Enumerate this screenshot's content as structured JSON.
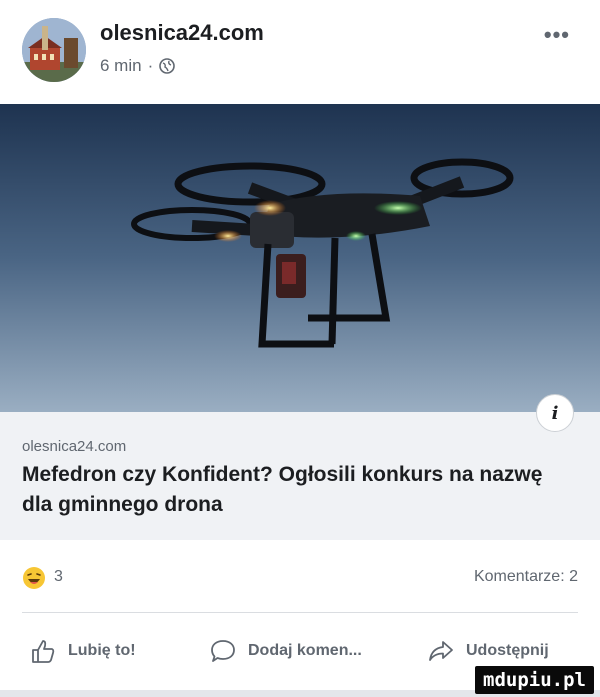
{
  "post": {
    "page_name": "olesnica24.com",
    "time": "6 min",
    "meta_separator": "·",
    "more_label": "•••"
  },
  "link": {
    "domain": "olesnica24.com",
    "headline": "Mefedron czy Konfident? Ogłosili konkurs na nazwę dla gminnego drona",
    "info_label": "i"
  },
  "stats": {
    "reactions_count": "3",
    "comments": "Komentarze: 2"
  },
  "actions": {
    "like": "Lubię to!",
    "comment": "Dodaj komen...",
    "share": "Udostępnij"
  },
  "watermark": "mdupiu.pl",
  "colors": {
    "text_primary": "#1c1e21",
    "text_secondary": "#606770",
    "link_box_bg": "#f0f2f5",
    "divider": "#dadde1"
  }
}
